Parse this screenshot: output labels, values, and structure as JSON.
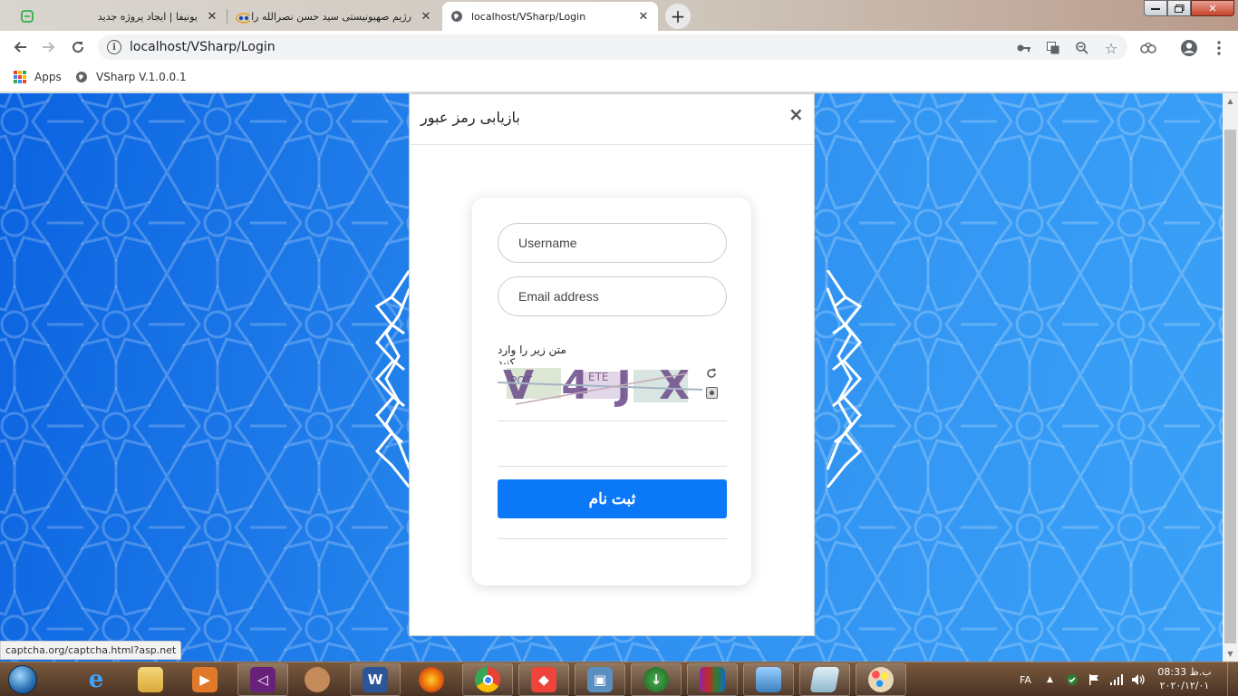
{
  "browser": {
    "tabs": [
      {
        "title": "یونیفا | ایجاد پروژه جدید",
        "active": false
      },
      {
        "title": "رژیم صهیونیستی سید حسن نصرالله را به ت",
        "active": false
      },
      {
        "title": "localhost/VSharp/Login",
        "active": true
      }
    ],
    "url": "localhost/VSharp/Login",
    "bookmarks": [
      {
        "label": "Apps"
      },
      {
        "label": "VSharp V.1.0.0.1"
      }
    ]
  },
  "modal": {
    "title": "بازیابی رمز عبور",
    "close_label": "×"
  },
  "form": {
    "username_placeholder": "Username",
    "email_placeholder": "Email address",
    "captcha_label": "متن زیر را وارد کنید",
    "captcha_text": "V4JX",
    "submit_label": "ثبت نام"
  },
  "status_url": "captcha.org/captcha.html?asp.net",
  "taskbar": {
    "language": "FA",
    "clock_time": "ب.ظ 08:33",
    "clock_date": "۲۰۲۰/۱۲/۰۱"
  },
  "colors": {
    "page_blue": "#2d8ef0",
    "submit_blue": "#0b79f7"
  }
}
